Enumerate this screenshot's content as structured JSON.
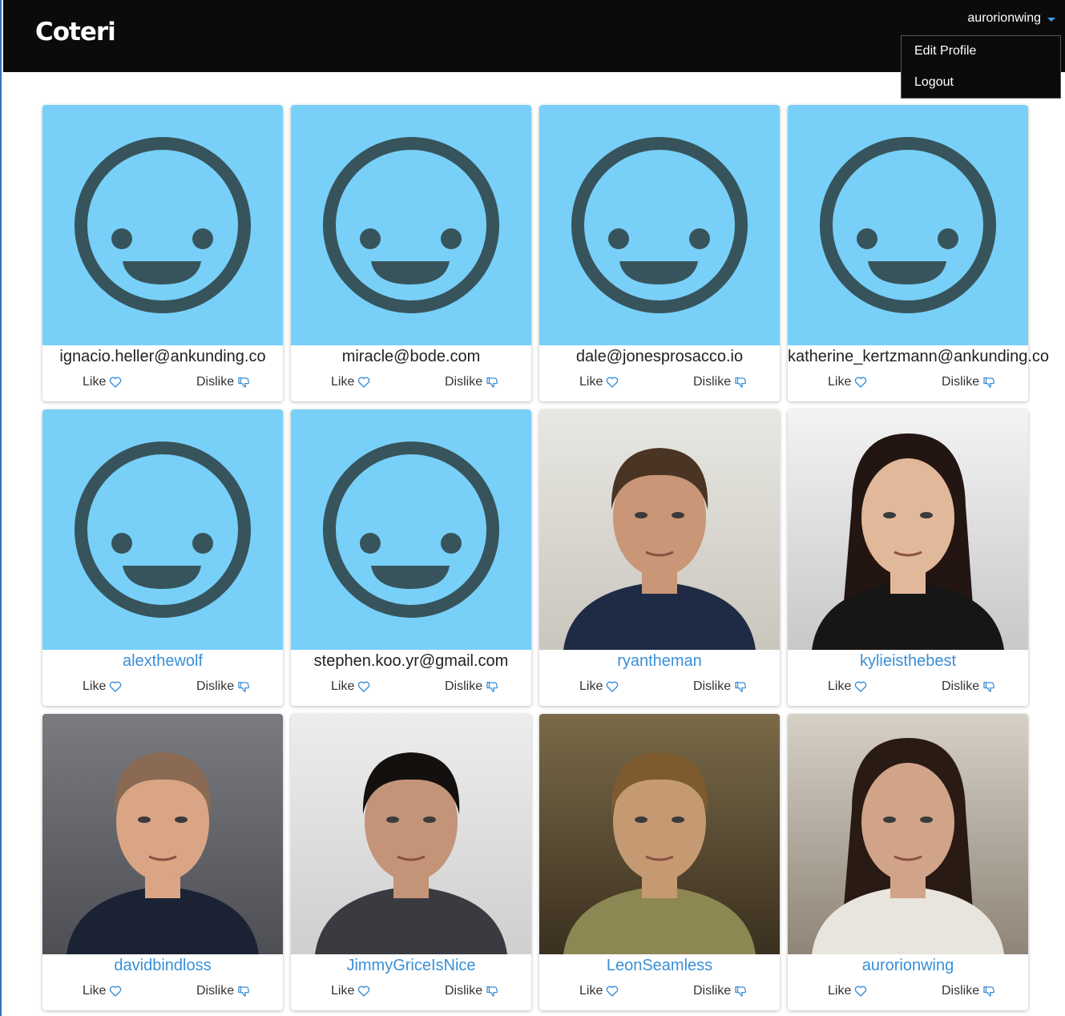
{
  "app": {
    "logo": "Coteri"
  },
  "user_menu": {
    "username": "aurorionwing",
    "items": [
      "Edit Profile",
      "Logout"
    ]
  },
  "actions": {
    "like": "Like",
    "dislike": "Dislike"
  },
  "colors": {
    "nav_bg": "#0b0b0b",
    "avatar_bg": "#78d0f8",
    "face": "#37545c",
    "link": "#3a8fd6",
    "heart": "#3a8fd6"
  },
  "cards": [
    {
      "name": "ignacio.heller@ankunding.co",
      "photo": "default-smiley-avatar",
      "name_is_link": false
    },
    {
      "name": "miracle@bode.com",
      "photo": "default-smiley-avatar",
      "name_is_link": false
    },
    {
      "name": "dale@jonesprosacco.io",
      "photo": "default-smiley-avatar",
      "name_is_link": false
    },
    {
      "name": "katherine_kertzmann@ankunding.co",
      "photo": "default-smiley-avatar",
      "name_is_link": false
    },
    {
      "name": "alexthewolf",
      "photo": "default-smiley-avatar",
      "name_is_link": true
    },
    {
      "name": "stephen.koo.yr@gmail.com",
      "photo": "default-smiley-avatar",
      "name_is_link": false
    },
    {
      "name": "ryantheman",
      "photo": "man-portrait-wavy-hair-navy-shirt",
      "name_is_link": true
    },
    {
      "name": "kylieisthebest",
      "photo": "woman-portrait-black-jacket-arms-crossed",
      "name_is_link": true
    },
    {
      "name": "davidbindloss",
      "photo": "man-portrait-suit-tie-grey-backdrop",
      "name_is_link": true
    },
    {
      "name": "JimmyGriceIsNice",
      "photo": "man-portrait-dark-hair-closeup",
      "name_is_link": true
    },
    {
      "name": "LeonSeamless",
      "photo": "man-portrait-curly-hair-beard",
      "name_is_link": true
    },
    {
      "name": "aurorionwing",
      "photo": "woman-portrait-long-dark-hair",
      "name_is_link": true
    }
  ]
}
